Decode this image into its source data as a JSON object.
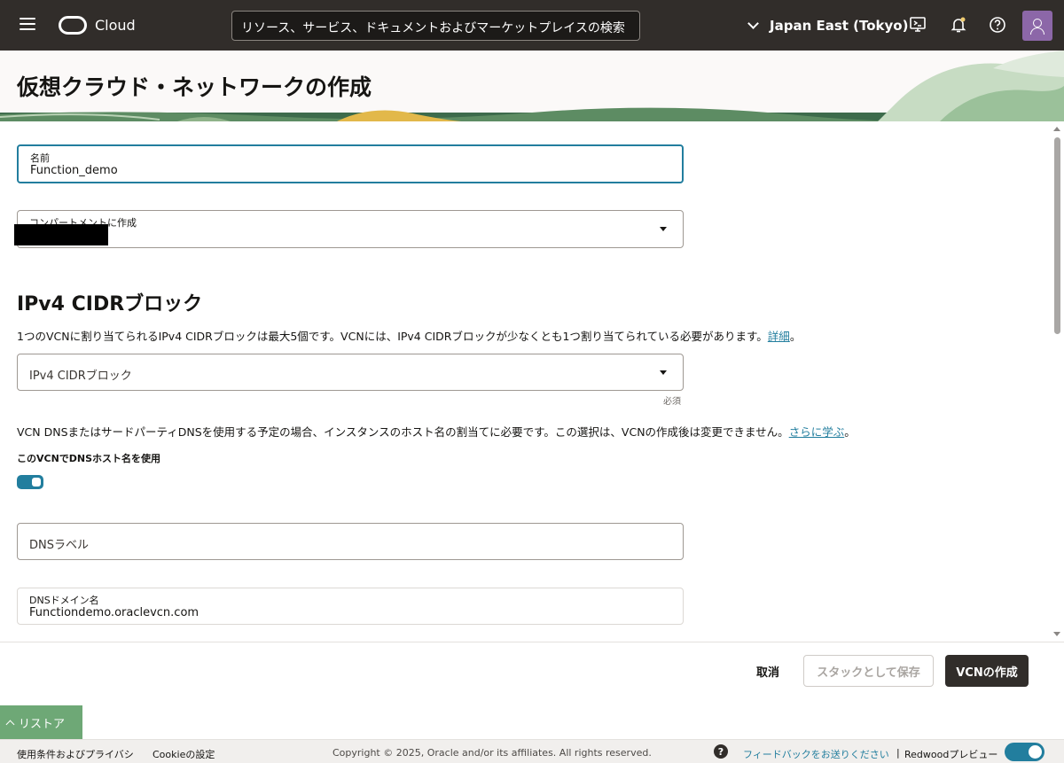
{
  "topbar": {
    "brand": "Cloud",
    "search_placeholder": "リソース、サービス、ドキュメントおよびマーケットプレイスの検索",
    "region": "Japan East (Tokyo)"
  },
  "page": {
    "title": "仮想クラウド・ネットワークの作成"
  },
  "form": {
    "name_label": "名前",
    "name_value": "Function_demo",
    "compartment_label": "コンパートメントに作成",
    "ipv4_heading": "IPv4 CIDRブロック",
    "ipv4_desc": "1つのVCNに割り当てられるIPv4 CIDRブロックは最大5個です。VCNには、IPv4 CIDRブロックが少なくとも1つ割り当てられている必要があります。",
    "ipv4_desc_link": "詳細",
    "ipv4_desc_end": "。",
    "ipv4_placeholder": "IPv4 CIDRブロック",
    "required": "必須",
    "dns_desc": "VCN DNSまたはサードパーティDNSを使用する予定の場合、インスタンスのホスト名の割当てに必要です。この選択は、VCNの作成後は変更できません。",
    "dns_desc_link": "さらに学ぶ",
    "dns_desc_end": "。",
    "dns_toggle_label": "このVCNでDNSホスト名を使用",
    "dns_toggle_on": true,
    "dns_label_placeholder": "DNSラベル",
    "dns_domain_label": "DNSドメイン名",
    "dns_domain_value": "Functiondemo.oraclevcn.com"
  },
  "actions": {
    "cancel": "取消",
    "save_stack": "スタックとして保存",
    "create": "VCNの作成"
  },
  "restore": {
    "label": "リストア"
  },
  "footer": {
    "terms": "使用条件およびプライバシ",
    "cookie": "Cookieの設定",
    "copyright": "Copyright © 2025, Oracle and/or its affiliates. All rights reserved.",
    "help_glyph": "?",
    "feedback": "フィードバックをお送りください",
    "separator": "|",
    "redwood": "Redwoodプレビュー"
  },
  "icons": {
    "menu": "hamburger-icon",
    "cloud_shell": "cloud-shell-icon",
    "notifications": "bell-icon",
    "help": "help-icon",
    "profile": "avatar-icon"
  },
  "colors": {
    "topbar": "#312d2a",
    "accent": "#227e9e",
    "restore_tab": "#6ea876",
    "primary_button": "#312d2a"
  }
}
